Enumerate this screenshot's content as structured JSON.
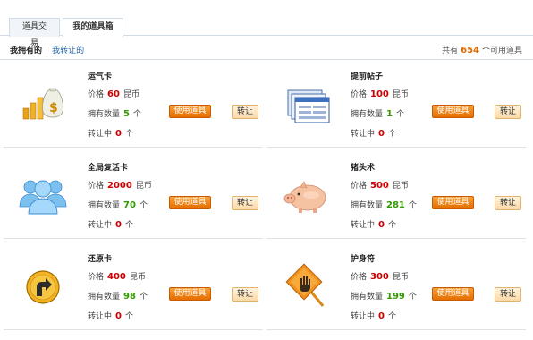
{
  "tabs": [
    {
      "label": "道具交易"
    },
    {
      "label": "我的道具箱"
    }
  ],
  "subnav": {
    "owned_label": "我拥有的",
    "separator": "|",
    "transferred_label": "我转让的"
  },
  "summary": {
    "prefix": "共有",
    "count": "654",
    "suffix": "个可用道具"
  },
  "labels": {
    "price": "价格",
    "currency": "昆币",
    "owned_qty": "拥有数量",
    "unit": "个",
    "transferring": "转让中",
    "use_button": "使用道具",
    "transfer_button": "转让"
  },
  "items": [
    {
      "name": "运气卡",
      "icon": "money-bag-icon",
      "price": "60",
      "qty": "5",
      "transferring": "0"
    },
    {
      "name": "提前帖子",
      "icon": "browser-window-icon",
      "price": "100",
      "qty": "1",
      "transferring": "0"
    },
    {
      "name": "全局复活卡",
      "icon": "user-group-icon",
      "price": "2000",
      "qty": "70",
      "transferring": "0"
    },
    {
      "name": "猪头术",
      "icon": "piggy-icon",
      "price": "500",
      "qty": "281",
      "transferring": "0"
    },
    {
      "name": "还原卡",
      "icon": "turn-arrow-icon",
      "price": "400",
      "qty": "98",
      "transferring": "0"
    },
    {
      "name": "护身符",
      "icon": "hand-sign-icon",
      "price": "300",
      "qty": "199",
      "transferring": "0"
    }
  ],
  "colors": {
    "price": "#cc0000",
    "qty": "#339900",
    "total": "#e06a00",
    "use_button": "#f08a1c"
  }
}
